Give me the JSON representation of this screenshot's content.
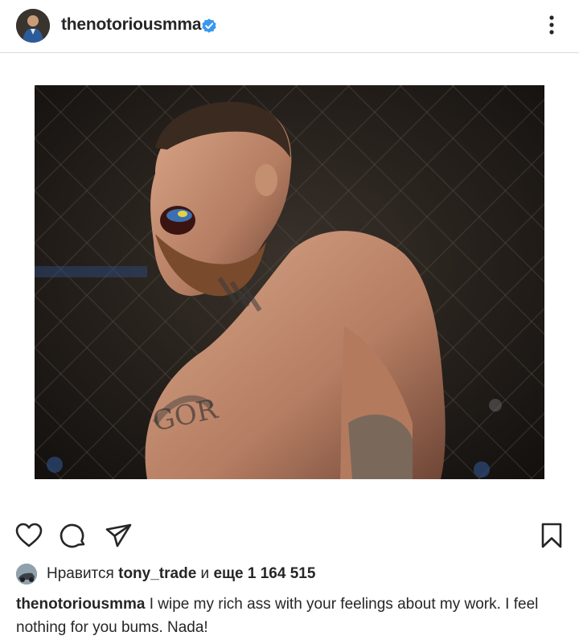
{
  "post": {
    "author": "thenotoriousmma",
    "verified": true
  },
  "icons": {
    "verified": "verified-badge-icon",
    "more": "more-vertical-icon",
    "like": "heart-icon",
    "comment": "comment-icon",
    "share": "paper-plane-icon",
    "save": "bookmark-icon"
  },
  "likes": {
    "prefix": "Нравится",
    "user": "tony_trade",
    "connector": "и",
    "more_label": "еще 1 164 515"
  },
  "caption": {
    "author": "thenotoriousmma",
    "text": "I wipe my rich ass with your feelings about my work. I feel nothing for you bums. Nada!"
  },
  "colors": {
    "verified_blue": "#3897f0",
    "text": "#262626",
    "divider": "#dbdbdb"
  }
}
